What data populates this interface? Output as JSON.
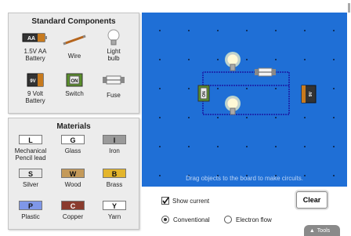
{
  "components": {
    "title": "Standard Components",
    "items": [
      {
        "label": "1.5V AA Battery",
        "glyph": "AA"
      },
      {
        "label": "Wire"
      },
      {
        "label": "Light bulb"
      },
      {
        "label": "9 Volt Battery",
        "glyph": "9V"
      },
      {
        "label": "Switch",
        "glyph": "ON"
      },
      {
        "label": "Fuse"
      }
    ]
  },
  "materials": {
    "title": "Materials",
    "items": [
      {
        "label": "Mechanical Pencil lead",
        "code": "L",
        "color": "#ffffff"
      },
      {
        "label": "Glass",
        "code": "G",
        "color": "#ffffff"
      },
      {
        "label": "Iron",
        "code": "I",
        "color": "#9a9a9a"
      },
      {
        "label": "Silver",
        "code": "S",
        "color": "#e8e8e8"
      },
      {
        "label": "Wood",
        "code": "W",
        "color": "#c49a5a"
      },
      {
        "label": "Brass",
        "code": "B",
        "color": "#e3b52c"
      },
      {
        "label": "Plastic",
        "code": "P",
        "color": "#7f97e8"
      },
      {
        "label": "Copper",
        "code": "C",
        "color": "#8a3b2e"
      },
      {
        "label": "Yarn",
        "code": "Y",
        "color": "#ffffff"
      }
    ]
  },
  "board": {
    "hint": "Drag objects to the board to make circuits.",
    "switch_label": "ON",
    "battery_label": "9V"
  },
  "controls": {
    "show_current_label": "Show current",
    "show_current_checked": true,
    "conventional_label": "Conventional",
    "electron_flow_label": "Electron flow",
    "selected_flow": "Conventional",
    "clear_label": "Clear",
    "tools_label": "Tools"
  },
  "colors": {
    "board": "#1f6fd6",
    "wire": "#1a2eb0"
  }
}
